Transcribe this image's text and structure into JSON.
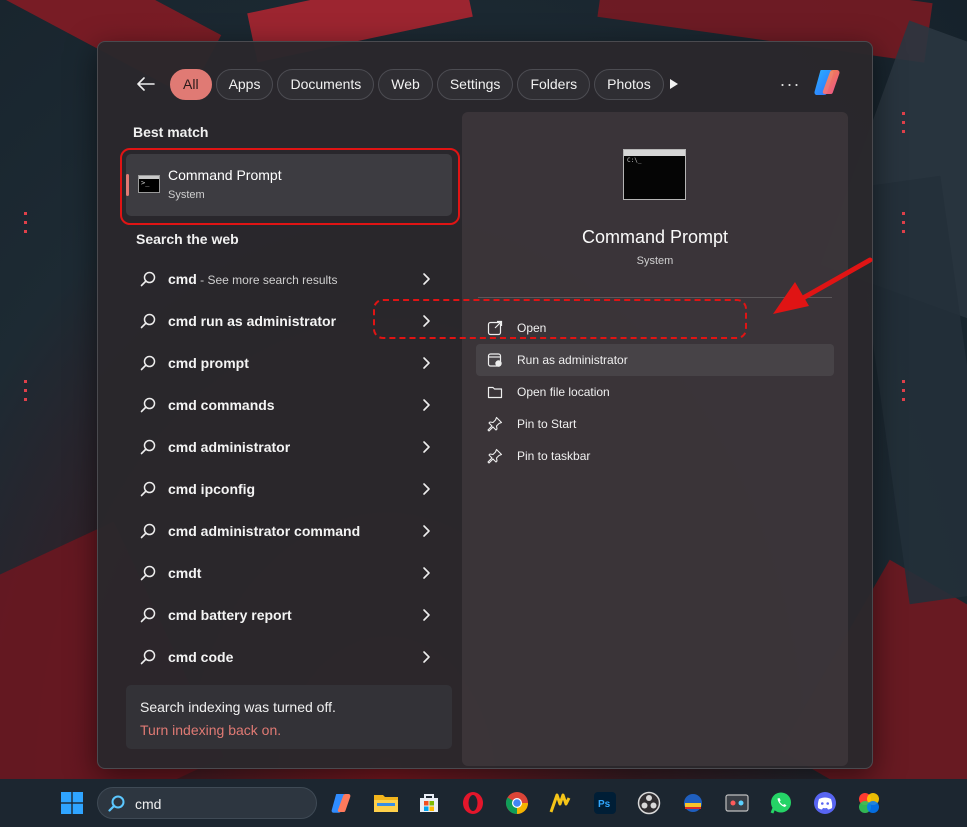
{
  "filters": {
    "back_label": "Back",
    "tabs": [
      "All",
      "Apps",
      "Documents",
      "Web",
      "Settings",
      "Folders",
      "Photos"
    ],
    "more_label": "···"
  },
  "best_match": {
    "heading": "Best match",
    "app_name": "Command Prompt",
    "app_type": "System"
  },
  "search_web": {
    "heading": "Search the web",
    "items": [
      {
        "text": "cmd",
        "extra": " - See more search results"
      },
      {
        "text": "cmd run as administrator",
        "extra": ""
      },
      {
        "text": "cmd prompt",
        "extra": ""
      },
      {
        "text": "cmd commands",
        "extra": ""
      },
      {
        "text": "cmd administrator",
        "extra": ""
      },
      {
        "text": "cmd ipconfig",
        "extra": ""
      },
      {
        "text": "cmd administrator command",
        "extra": ""
      },
      {
        "text": "cmdt",
        "extra": ""
      },
      {
        "text": "cmd battery report",
        "extra": ""
      },
      {
        "text": "cmd code",
        "extra": ""
      }
    ]
  },
  "indexing": {
    "message": "Search indexing was turned off.",
    "link": "Turn indexing back on."
  },
  "preview": {
    "title": "Command Prompt",
    "subtitle": "System",
    "actions": [
      {
        "label": "Open",
        "icon": "open-external-icon"
      },
      {
        "label": "Run as administrator",
        "icon": "shield-admin-icon"
      },
      {
        "label": "Open file location",
        "icon": "folder-icon"
      },
      {
        "label": "Pin to Start",
        "icon": "pin-icon"
      },
      {
        "label": "Pin to taskbar",
        "icon": "pin-icon"
      }
    ]
  },
  "taskbar": {
    "search_value": "cmd",
    "apps": [
      "copilot-icon",
      "file-explorer-icon",
      "microsoft-store-icon",
      "opera-icon",
      "chrome-icon",
      "app-icon",
      "photoshop-icon",
      "obs-icon",
      "app-icon",
      "app-icon",
      "whatsapp-icon",
      "discord-icon",
      "app-icon"
    ]
  },
  "colors": {
    "accent": "#e07a74",
    "highlight_box": "#e01414"
  }
}
